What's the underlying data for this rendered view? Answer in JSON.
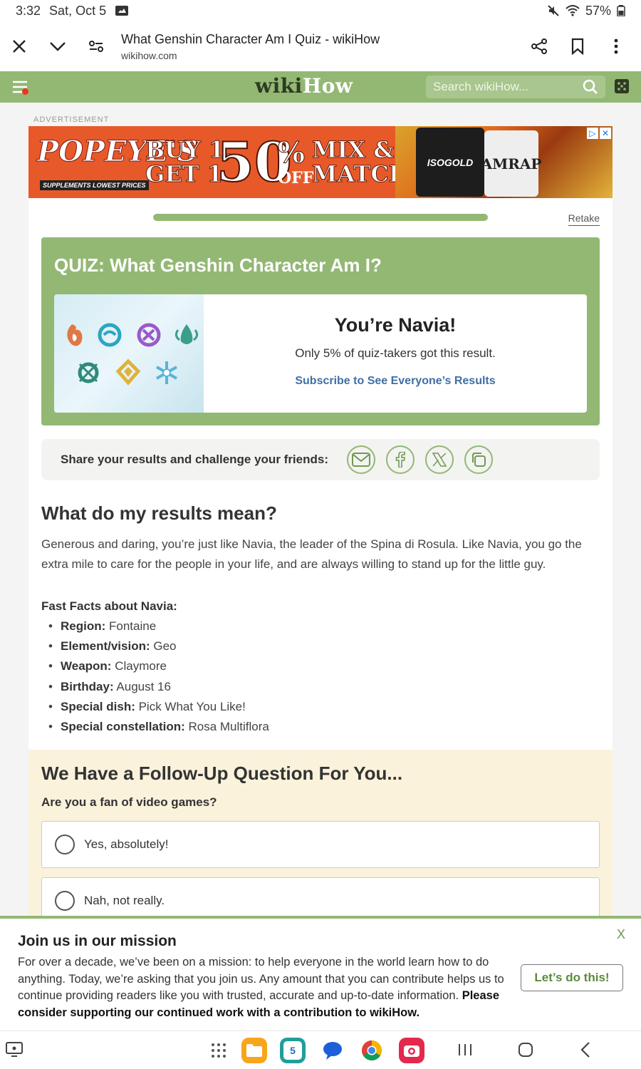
{
  "status_bar": {
    "time": "3:32",
    "date": "Sat, Oct 5",
    "battery": "57%"
  },
  "tab": {
    "title": "What Genshin Character Am I Quiz - wikiHow",
    "url": "wikihow.com"
  },
  "header": {
    "logo_wiki": "wiki",
    "logo_how": "How",
    "search_placeholder": "Search wikiHow..."
  },
  "ad": {
    "label": "ADVERTISEMENT",
    "brand": "POPEYE'S",
    "brand_sub": "SUPPLEMENTS LOWEST PRICES",
    "line1": "BUY 1,",
    "line2": "GET 1",
    "big": "50",
    "pct": "%",
    "off": "OFF",
    "mix1": "MIX &",
    "mix2": "MATCH!",
    "product1": "ISOGOLD",
    "product2": "AMRAP"
  },
  "quiz": {
    "retake": "Retake",
    "progress": 1.0,
    "title": "QUIZ: What Genshin Character Am I?",
    "result_name": "You’re Navia!",
    "result_stat": "Only 5% of quiz-takers got this result.",
    "subscribe_link": "Subscribe to See Everyone’s Results"
  },
  "share": {
    "label": "Share your results and challenge your friends:"
  },
  "meaning": {
    "heading": "What do my results mean?",
    "paragraph": "Generous and daring, you’re just like Navia, the leader of the Spina di Rosula. Like Navia, you go the extra mile to care for the people in your life, and are always willing to stand up for the little guy.",
    "facts_title": "Fast Facts about Navia:",
    "facts": [
      {
        "k": "Region:",
        "v": " Fontaine"
      },
      {
        "k": "Element/vision:",
        "v": " Geo"
      },
      {
        "k": "Weapon:",
        "v": " Claymore"
      },
      {
        "k": "Birthday:",
        "v": " August 16"
      },
      {
        "k": "Special dish:",
        "v": " Pick What You Like!"
      },
      {
        "k": "Special constellation:",
        "v": " Rosa Multiflora"
      }
    ]
  },
  "followup": {
    "heading": "We Have a Follow-Up Question For You...",
    "question": "Are you a fan of video games?",
    "options": [
      "Yes, absolutely!",
      "Nah, not really."
    ]
  },
  "banner": {
    "title": "Join us in our mission",
    "body": "For over a decade, we’ve been on a mission: to help everyone in the world learn how to do anything. Today, we’re asking that you join us. Any amount that you can contribute helps us to continue providing readers like you with trusted, accurate and up-to-date information.",
    "body_bold": "Please consider supporting our continued work with a contribution to wikiHow.",
    "cta": "Let’s do this!",
    "close": "X"
  },
  "dock": {
    "calendar_day": "5"
  },
  "colors": {
    "accent_green": "#93b874",
    "link_blue": "#3f6fa5",
    "cream": "#fbf2dc"
  }
}
